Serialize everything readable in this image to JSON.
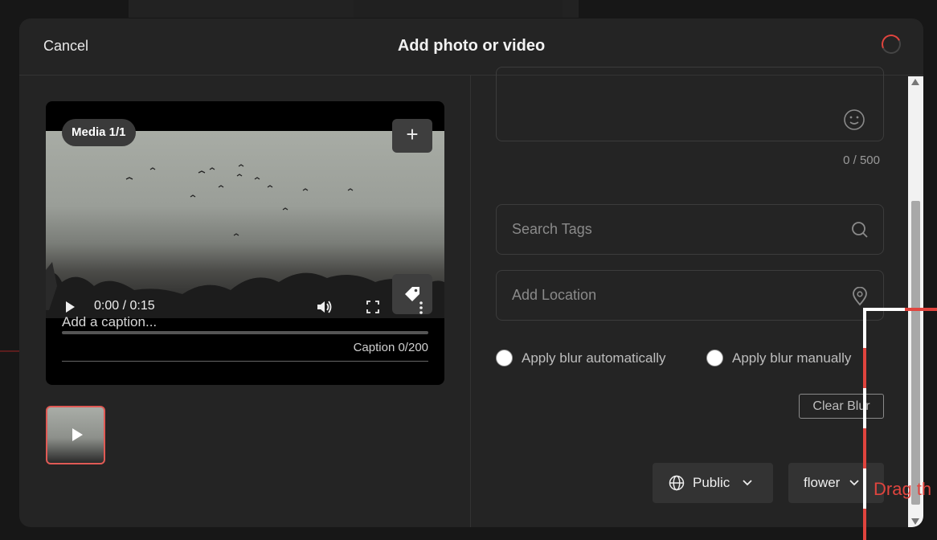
{
  "header": {
    "cancel_label": "Cancel",
    "title": "Add photo or video"
  },
  "media": {
    "badge": "Media 1/1",
    "time": "0:00 / 0:15",
    "caption_placeholder": "Add a caption...",
    "caption_count": "Caption 0/200"
  },
  "form": {
    "char_count": "0 / 500",
    "tags_placeholder": "Search Tags",
    "location_placeholder": "Add Location",
    "blur_auto_label": "Apply blur automatically",
    "blur_manual_label": "Apply blur manually",
    "clear_blur_label": "Clear Blur",
    "privacy_value": "Public",
    "category_value": "flower"
  },
  "overlay": {
    "drag_text": "Drag th"
  },
  "colors": {
    "accent": "#e0443e",
    "modal_bg": "#242424",
    "field_border": "#3c3c3c"
  },
  "icons": [
    "plus-icon",
    "tag-icon",
    "play-icon",
    "volume-icon",
    "fullscreen-icon",
    "more-icon",
    "emoji-icon",
    "search-icon",
    "location-pin-icon",
    "globe-icon",
    "chevron-down-icon"
  ]
}
